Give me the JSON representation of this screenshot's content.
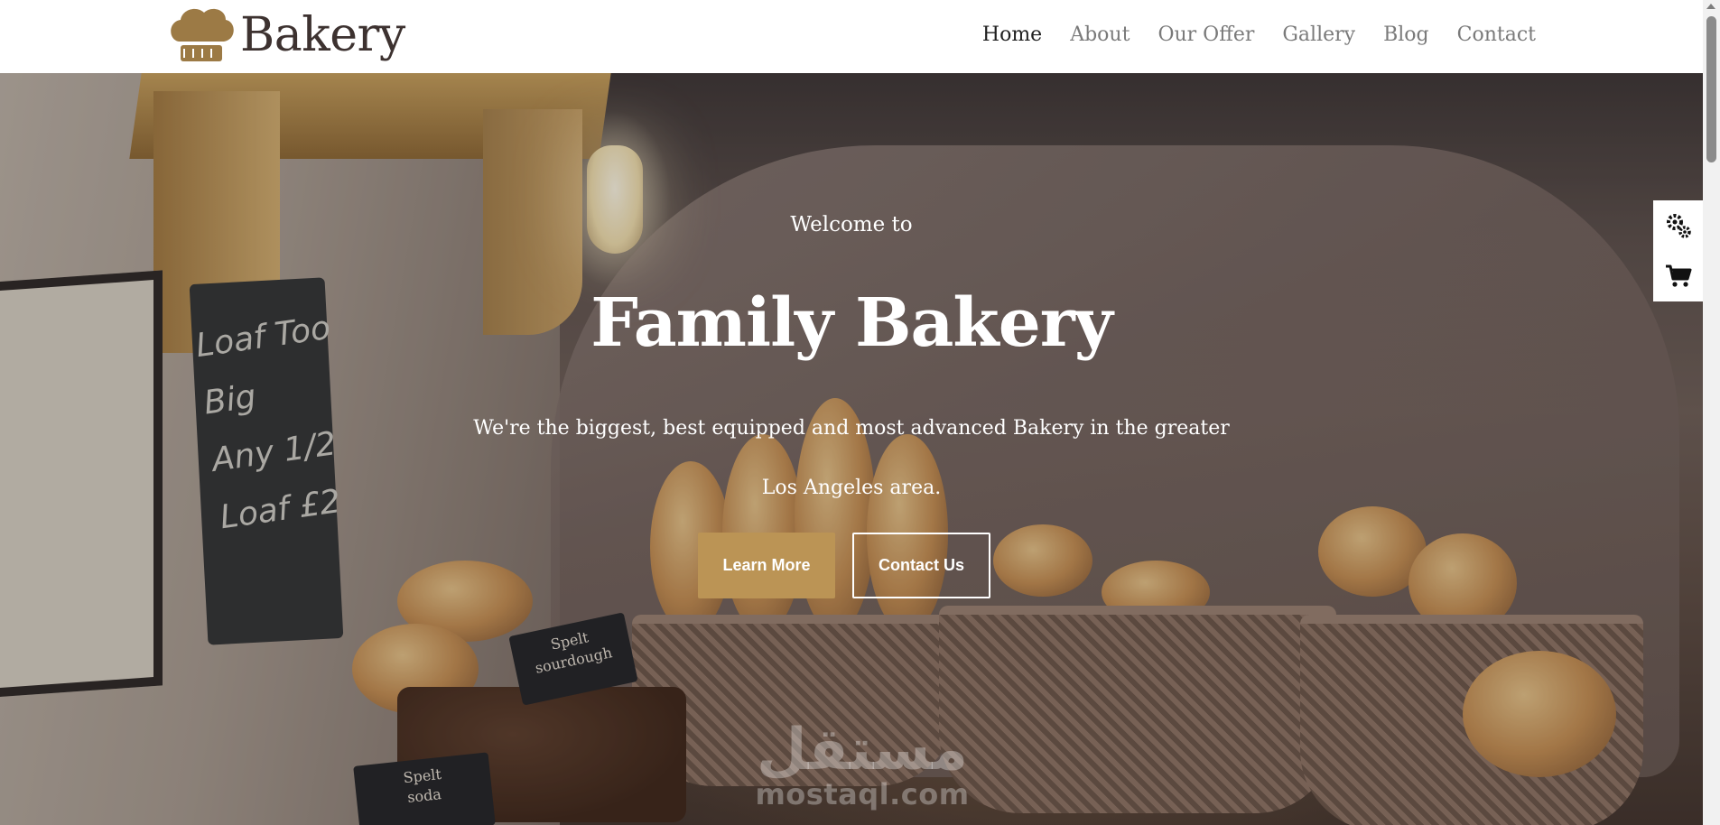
{
  "brand": {
    "name": "Bakery",
    "logo_icon": "chef-hat-icon",
    "logo_color": "#9c7a45"
  },
  "nav": {
    "items": [
      {
        "label": "Home",
        "active": true
      },
      {
        "label": "About",
        "active": false
      },
      {
        "label": "Our Offer",
        "active": false
      },
      {
        "label": "Gallery",
        "active": false
      },
      {
        "label": "Blog",
        "active": false
      },
      {
        "label": "Contact",
        "active": false
      }
    ]
  },
  "hero": {
    "welcome": "Welcome to",
    "title": "Family Bakery",
    "description": "We're the biggest, best equipped and most advanced Bakery in the greater Los Angeles area.",
    "buttons": {
      "primary": "Learn More",
      "secondary": "Contact Us"
    },
    "accent_color": "#bb9455",
    "scene_text": {
      "chalkboard": [
        "Loaf Too",
        "Big",
        "Any 1/2",
        "Loaf £2"
      ],
      "sign_spelt_sourdough": [
        "Spelt",
        "sourdough"
      ],
      "sign_spelt_soda": [
        "Spelt",
        "soda"
      ]
    }
  },
  "side_widget": {
    "icons": [
      "gears-icon",
      "cart-icon"
    ]
  },
  "watermark": {
    "arabic": "مستقل",
    "latin": "mostaql.com"
  }
}
